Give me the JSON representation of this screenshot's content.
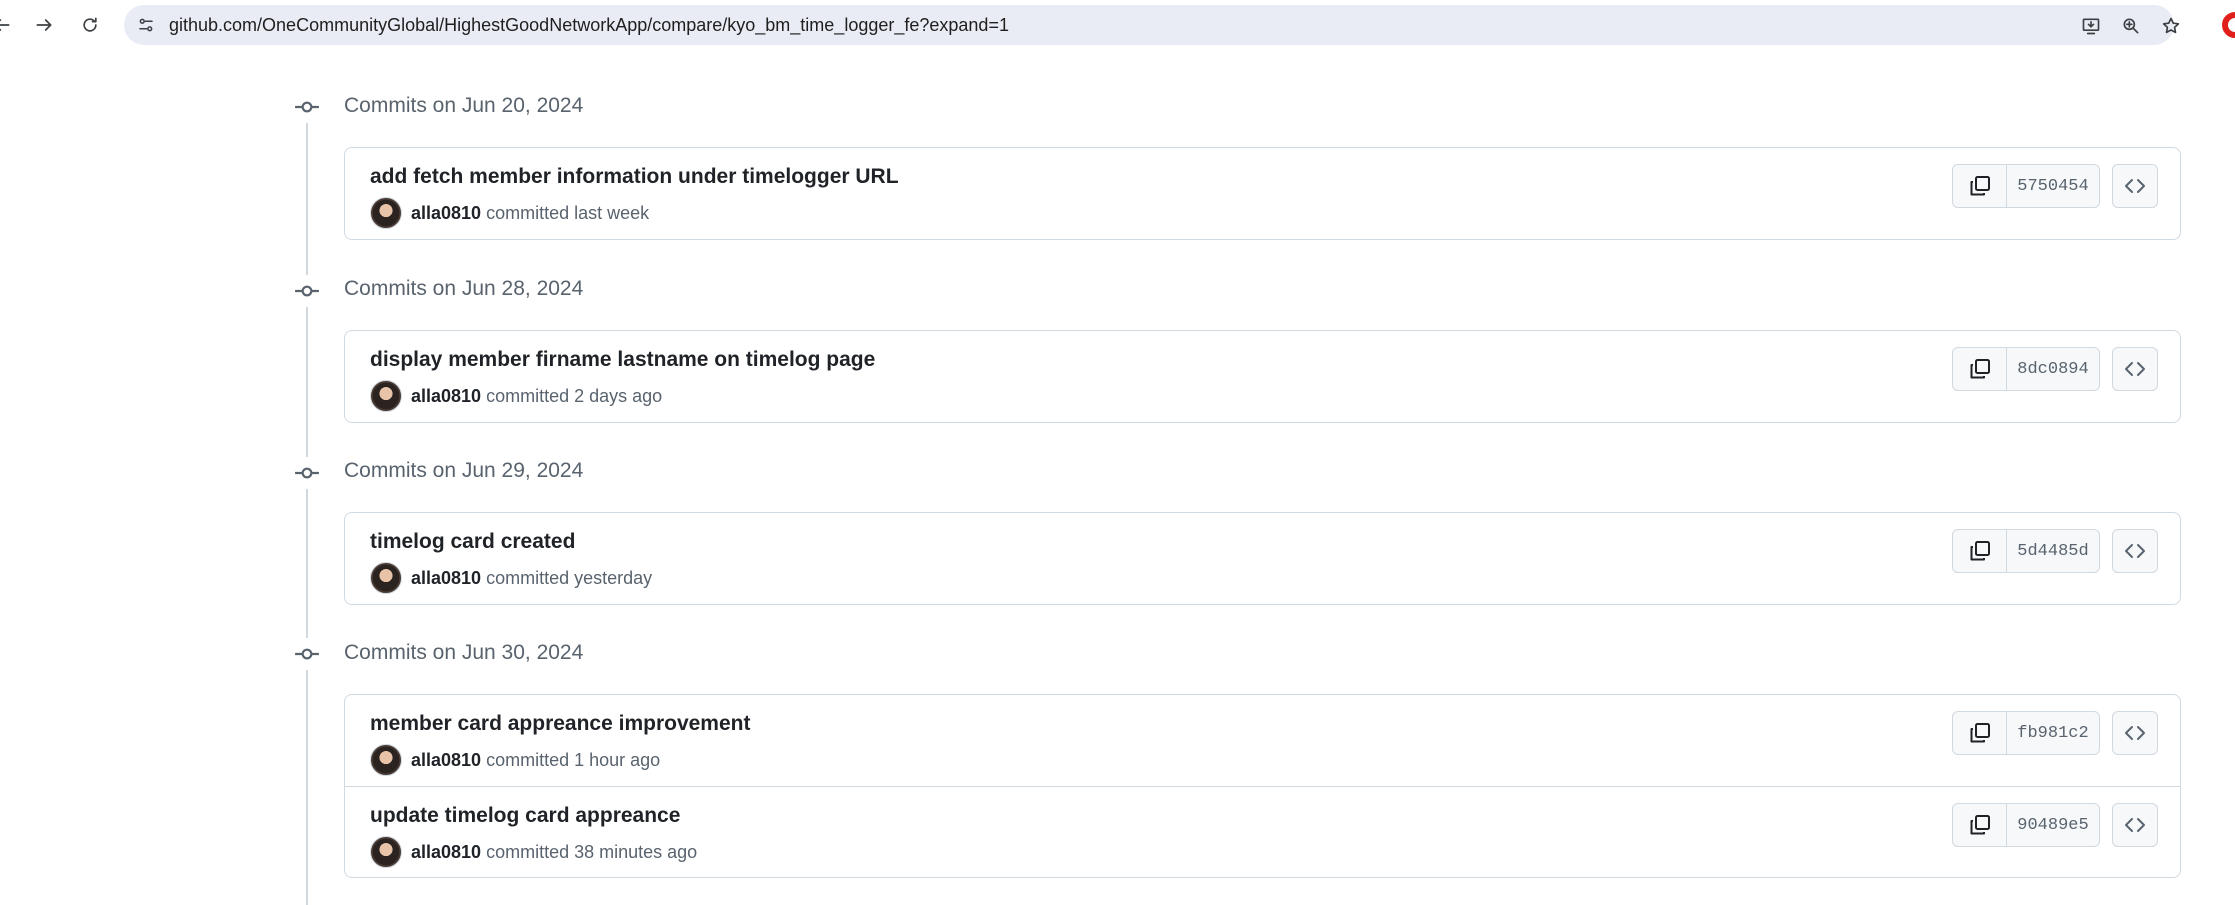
{
  "browser": {
    "url": "github.com/OneCommunityGlobal/HighestGoodNetworkApp/compare/kyo_bm_time_logger_fe?expand=1"
  },
  "groups": [
    {
      "heading": "Commits on Jun 20, 2024",
      "commits": [
        {
          "title": "add fetch member information under timelogger URL",
          "author": "alla0810",
          "committed": "committed",
          "time": "last week",
          "sha": "5750454"
        }
      ]
    },
    {
      "heading": "Commits on Jun 28, 2024",
      "commits": [
        {
          "title": "display member firname lastname on timelog page",
          "author": "alla0810",
          "committed": "committed",
          "time": "2 days ago",
          "sha": "8dc0894"
        }
      ]
    },
    {
      "heading": "Commits on Jun 29, 2024",
      "commits": [
        {
          "title": "timelog card created",
          "author": "alla0810",
          "committed": "committed",
          "time": "yesterday",
          "sha": "5d4485d"
        }
      ]
    },
    {
      "heading": "Commits on Jun 30, 2024",
      "commits": [
        {
          "title": "member card appreance improvement",
          "author": "alla0810",
          "committed": "committed",
          "time": "1 hour ago",
          "sha": "fb981c2"
        },
        {
          "title": "update timelog card appreance",
          "author": "alla0810",
          "committed": "committed",
          "time": "38 minutes ago",
          "sha": "90489e5"
        }
      ]
    }
  ],
  "icons": {
    "back": "arrow-left-icon",
    "forward": "arrow-right-icon",
    "reload": "reload-icon",
    "site_info": "tune-icon",
    "install": "install-app-icon",
    "zoom": "zoom-icon",
    "bookmark": "star-icon",
    "node": "git-commit-icon",
    "copy": "copy-icon",
    "browse": "code-icon"
  },
  "colors": {
    "omnibox": "#e9ecf5",
    "border": "#d1d9e0",
    "muted_text": "#59636e",
    "text": "#1f2328",
    "browser_logo": "#e0201b"
  }
}
